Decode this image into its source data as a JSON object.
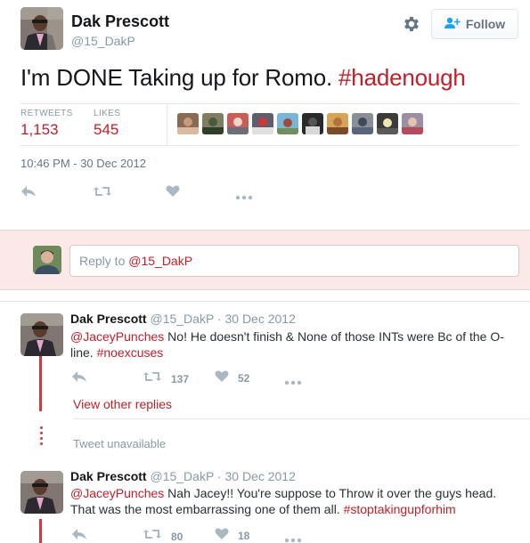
{
  "tweet": {
    "author_name": "Dak Prescott",
    "author_handle": "@15_DakP",
    "follow_label": "Follow",
    "text": "I'm DONE Taking up for Romo. ",
    "hashtag": "#hadenough",
    "retweets_label": "RETWEETS",
    "retweets_count": "1,153",
    "likes_label": "LIKES",
    "likes_count": "545",
    "timestamp": "10:46 PM - 30 Dec 2012",
    "likers_count_shown": 10
  },
  "reply_box": {
    "prefix": "Reply to ",
    "mention": "@15_DakP"
  },
  "replies": [
    {
      "author_name": "Dak Prescott",
      "meta": " @15_DakP · 30 Dec 2012",
      "mention": "@JaceyPunches",
      "body": " No! He doesn't finish & None of those INTs were Bc of the O-line. ",
      "hashtag": "#noexcuses",
      "retweets": "137",
      "likes": "52"
    },
    {
      "author_name": "Dak Prescott",
      "meta": " @15_DakP · 30 Dec 2012",
      "mention": "@JaceyPunches",
      "body": " Nah Jacey!! You're suppose to Throw it over the guys head. That was the most embarrassing one of them all. ",
      "hashtag": "#stoptakingupforhim",
      "retweets": "80",
      "likes": "18"
    }
  ],
  "conversation": {
    "view_other_replies": "View other replies",
    "tweet_unavailable": "Tweet unavailable"
  },
  "colors": {
    "accent": "#c0202a",
    "thread_line": "#d03a3f",
    "muted": "#8899a6",
    "reply_bar_bg": "#fbe9ea"
  },
  "icons": [
    "gear-icon",
    "add-user-icon",
    "reply-icon",
    "retweet-icon",
    "heart-icon",
    "more-icon"
  ]
}
